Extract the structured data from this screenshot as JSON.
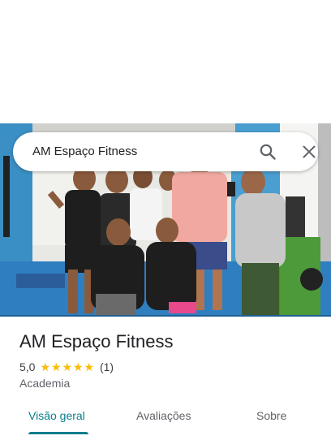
{
  "search": {
    "query": "AM Espaço Fitness"
  },
  "place": {
    "title": "AM Espaço Fitness",
    "rating": "5,0",
    "stars": 5,
    "review_count": "(1)",
    "category": "Academia"
  },
  "tabs": [
    {
      "label": "Visão geral",
      "active": true
    },
    {
      "label": "Avaliações",
      "active": false
    },
    {
      "label": "Sobre",
      "active": false
    }
  ],
  "colors": {
    "accent": "#087d8c",
    "star": "#fbbc04"
  }
}
